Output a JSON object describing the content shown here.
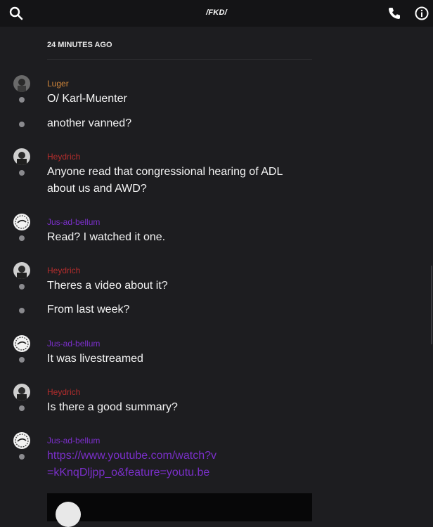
{
  "header": {
    "title": "/FKD/",
    "icons": [
      "search-icon",
      "phone-icon",
      "info-icon"
    ]
  },
  "timestamp": "24 MINUTES AGO",
  "colors": {
    "luger": "#d2873b",
    "heydrich": "#b32d2d",
    "jus": "#7a2fc9",
    "link": "#7a2fc9"
  },
  "messages": [
    {
      "author": "Luger",
      "lines": [
        "O/ Karl-Muenter",
        "another vanned?"
      ]
    },
    {
      "author": "Heydrich",
      "lines": [
        "Anyone read that congressional hearing of ADL about us and AWD?"
      ]
    },
    {
      "author": "Jus-ad-bellum",
      "lines": [
        "Read? I watched it one."
      ]
    },
    {
      "author": "Heydrich",
      "lines": [
        "Theres a video about it?",
        "From last week?"
      ]
    },
    {
      "author": "Jus-ad-bellum",
      "lines": [
        "It was livestreamed"
      ]
    },
    {
      "author": "Heydrich",
      "lines": [
        "Is there a good summary?"
      ]
    },
    {
      "author": "Jus-ad-bellum",
      "lines": [
        "https://www.youtube.com/watch?v=kKnqDljpp_o&feature=youtu.be"
      ]
    }
  ]
}
